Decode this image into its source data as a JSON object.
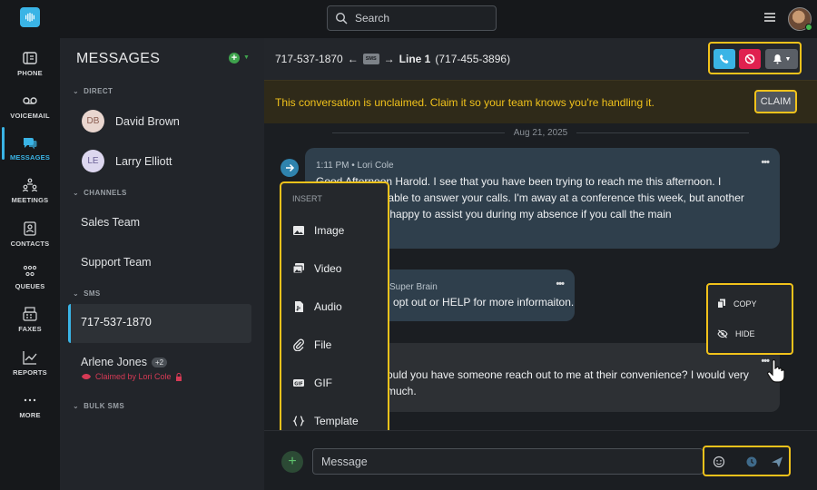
{
  "nav": {
    "items": [
      {
        "label": "PHONE",
        "icon": "phone-icon"
      },
      {
        "label": "VOICEMAIL",
        "icon": "voicemail-icon"
      },
      {
        "label": "MESSAGES",
        "icon": "messages-icon"
      },
      {
        "label": "MEETINGS",
        "icon": "meetings-icon"
      },
      {
        "label": "CONTACTS",
        "icon": "contacts-icon"
      },
      {
        "label": "QUEUES",
        "icon": "queues-icon"
      },
      {
        "label": "FAXES",
        "icon": "faxes-icon"
      },
      {
        "label": "REPORTS",
        "icon": "reports-icon"
      },
      {
        "label": "MORE",
        "icon": "more-icon"
      }
    ],
    "active": "MESSAGES"
  },
  "topbar": {
    "search_placeholder": "Search"
  },
  "sidebar": {
    "title": "MESSAGES",
    "sections": {
      "direct": "DIRECT",
      "channels": "CHANNELS",
      "sms": "SMS",
      "bulk_sms": "BULK SMS"
    },
    "direct": [
      {
        "initials": "DB",
        "name": "David Brown"
      },
      {
        "initials": "LE",
        "name": "Larry Elliott"
      }
    ],
    "channels": [
      "Sales Team",
      "Support Team"
    ],
    "sms": {
      "active": "717-537-1870",
      "other": {
        "name": "Arlene Jones",
        "badge": "+2",
        "claimed": "Claimed by Lori Cole"
      }
    }
  },
  "conversation": {
    "from": "717-537-1870",
    "via_chip": "SMS",
    "line_label": "Line 1",
    "line_number": "(717-455-3896)",
    "banner": "This conversation is unclaimed. Claim it so your team knows you're handling it.",
    "claim_label": "CLAIM",
    "date": "Aug 21, 2025",
    "messages": [
      {
        "meta": "1:11 PM • Lori Cole",
        "text": "Good Afternoon Harold. I see that you have been trying to reach me this afternoon. I apologize available to answer your calls. I'm away at a conference this week, but another team would be happy to assist you during my absence if you call the main"
      },
      {
        "meta": "Super Brain",
        "text": "opt out or HELP for more informaiton."
      },
      {
        "meta": "",
        "text": "ould you have someone reach out to me at their convenience? I would very much."
      }
    ],
    "more_label": "•••"
  },
  "insert_menu": {
    "header": "INSERT",
    "items": [
      {
        "label": "Image",
        "icon": "image-icon"
      },
      {
        "label": "Video",
        "icon": "video-icon"
      },
      {
        "label": "Audio",
        "icon": "audio-icon"
      },
      {
        "label": "File",
        "icon": "attachment-icon"
      },
      {
        "label": "GIF",
        "icon": "gif-icon"
      },
      {
        "label": "Template",
        "icon": "template-icon"
      }
    ]
  },
  "context_menu": {
    "copy": "COPY",
    "hide": "HIDE"
  },
  "composer": {
    "placeholder": "Message",
    "plus": "+"
  },
  "colors": {
    "accent": "#3ab4e6",
    "highlight": "#f1c21b",
    "danger": "#e0204f",
    "success": "#3fa34d"
  }
}
